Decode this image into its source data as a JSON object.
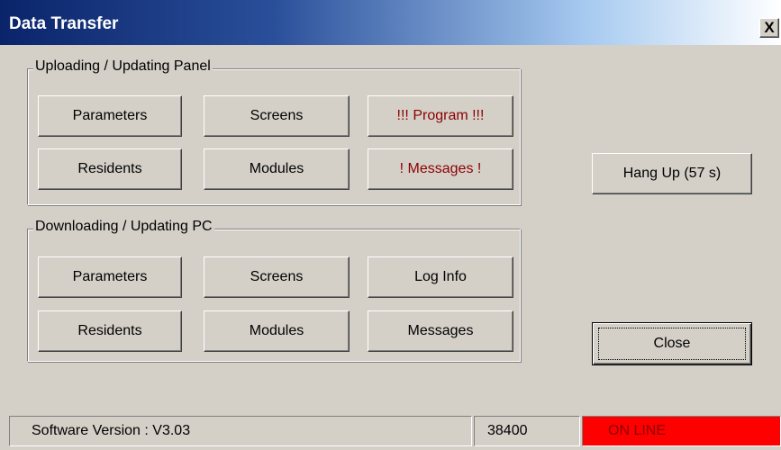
{
  "window": {
    "title": "Data Transfer",
    "close_glyph": "X"
  },
  "upload_group": {
    "label": "Uploading / Updating Panel",
    "buttons": [
      {
        "label": "Parameters"
      },
      {
        "label": "Screens"
      },
      {
        "label": "!!! Program !!!"
      },
      {
        "label": "Residents"
      },
      {
        "label": "Modules"
      },
      {
        "label": "! Messages !"
      }
    ]
  },
  "download_group": {
    "label": "Downloading / Updating PC",
    "buttons": [
      {
        "label": "Parameters"
      },
      {
        "label": "Screens"
      },
      {
        "label": "Log Info"
      },
      {
        "label": "Residents"
      },
      {
        "label": "Modules"
      },
      {
        "label": "Messages"
      }
    ]
  },
  "actions": {
    "hangup_label": "Hang Up (57 s)",
    "close_label": "Close"
  },
  "status": {
    "version": "Software Version : V3.03",
    "baud": "38400",
    "connection": "ON LINE",
    "connection_color": "#ff0000"
  },
  "colors": {
    "warning_text": "#8b0000",
    "face": "#d4d0c8"
  }
}
